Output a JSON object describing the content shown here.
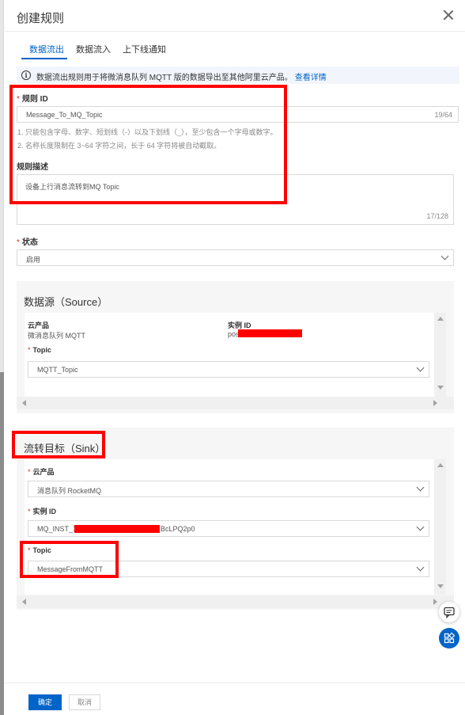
{
  "dialog": {
    "title": "创建规则"
  },
  "tabs": [
    {
      "label": "数据流出",
      "active": true
    },
    {
      "label": "数据流入",
      "active": false
    },
    {
      "label": "上下线通知",
      "active": false
    }
  ],
  "notice": {
    "text": "数据流出规则用于将微消息队列 MQTT 版的数据导出至其他阿里云产品。",
    "link": "查看详情"
  },
  "form": {
    "rule_id": {
      "label": "规则 ID",
      "value": "Message_To_MQ_Topic",
      "counter": "19/64",
      "hints": [
        "1. 只能包含字母、数字、短划线（-）以及下划线（_），至少包含一个字母或数字。",
        "2. 名称长度限制在 3~64 字符之间，长于 64 字符将被自动截取。"
      ]
    },
    "description": {
      "label": "规则描述",
      "value": "设备上行消息流转到MQ Topic",
      "counter": "17/128"
    },
    "status": {
      "label": "状态",
      "value": "启用"
    }
  },
  "source": {
    "title": "数据源（Source）",
    "product_key": "云产品",
    "product_value": "微消息队列 MQTT",
    "instance_key": "实例 ID",
    "instance_value_prefix": "pos",
    "topic_label": "Topic",
    "topic_value": "MQTT_Topic"
  },
  "sink": {
    "title": "流转目标（Sink）",
    "product_label": "云产品",
    "product_value": "消息队列 RocketMQ",
    "instance_label": "实例 ID",
    "instance_value_prefix": "MQ_INST_1",
    "instance_value_suffix": "BcLPQ2p0",
    "topic_label": "Topic",
    "topic_value": "MessageFromMQTT"
  },
  "footer": {
    "confirm": "确定",
    "cancel": "取消"
  },
  "icons": {
    "notice": "info-circle-icon",
    "close": "close-icon",
    "chat": "chat-bubble-icon",
    "apps": "apps-grid-icon"
  },
  "colors": {
    "primary": "#0064c8",
    "annotation": "#ff0000",
    "required": "#d93026"
  }
}
